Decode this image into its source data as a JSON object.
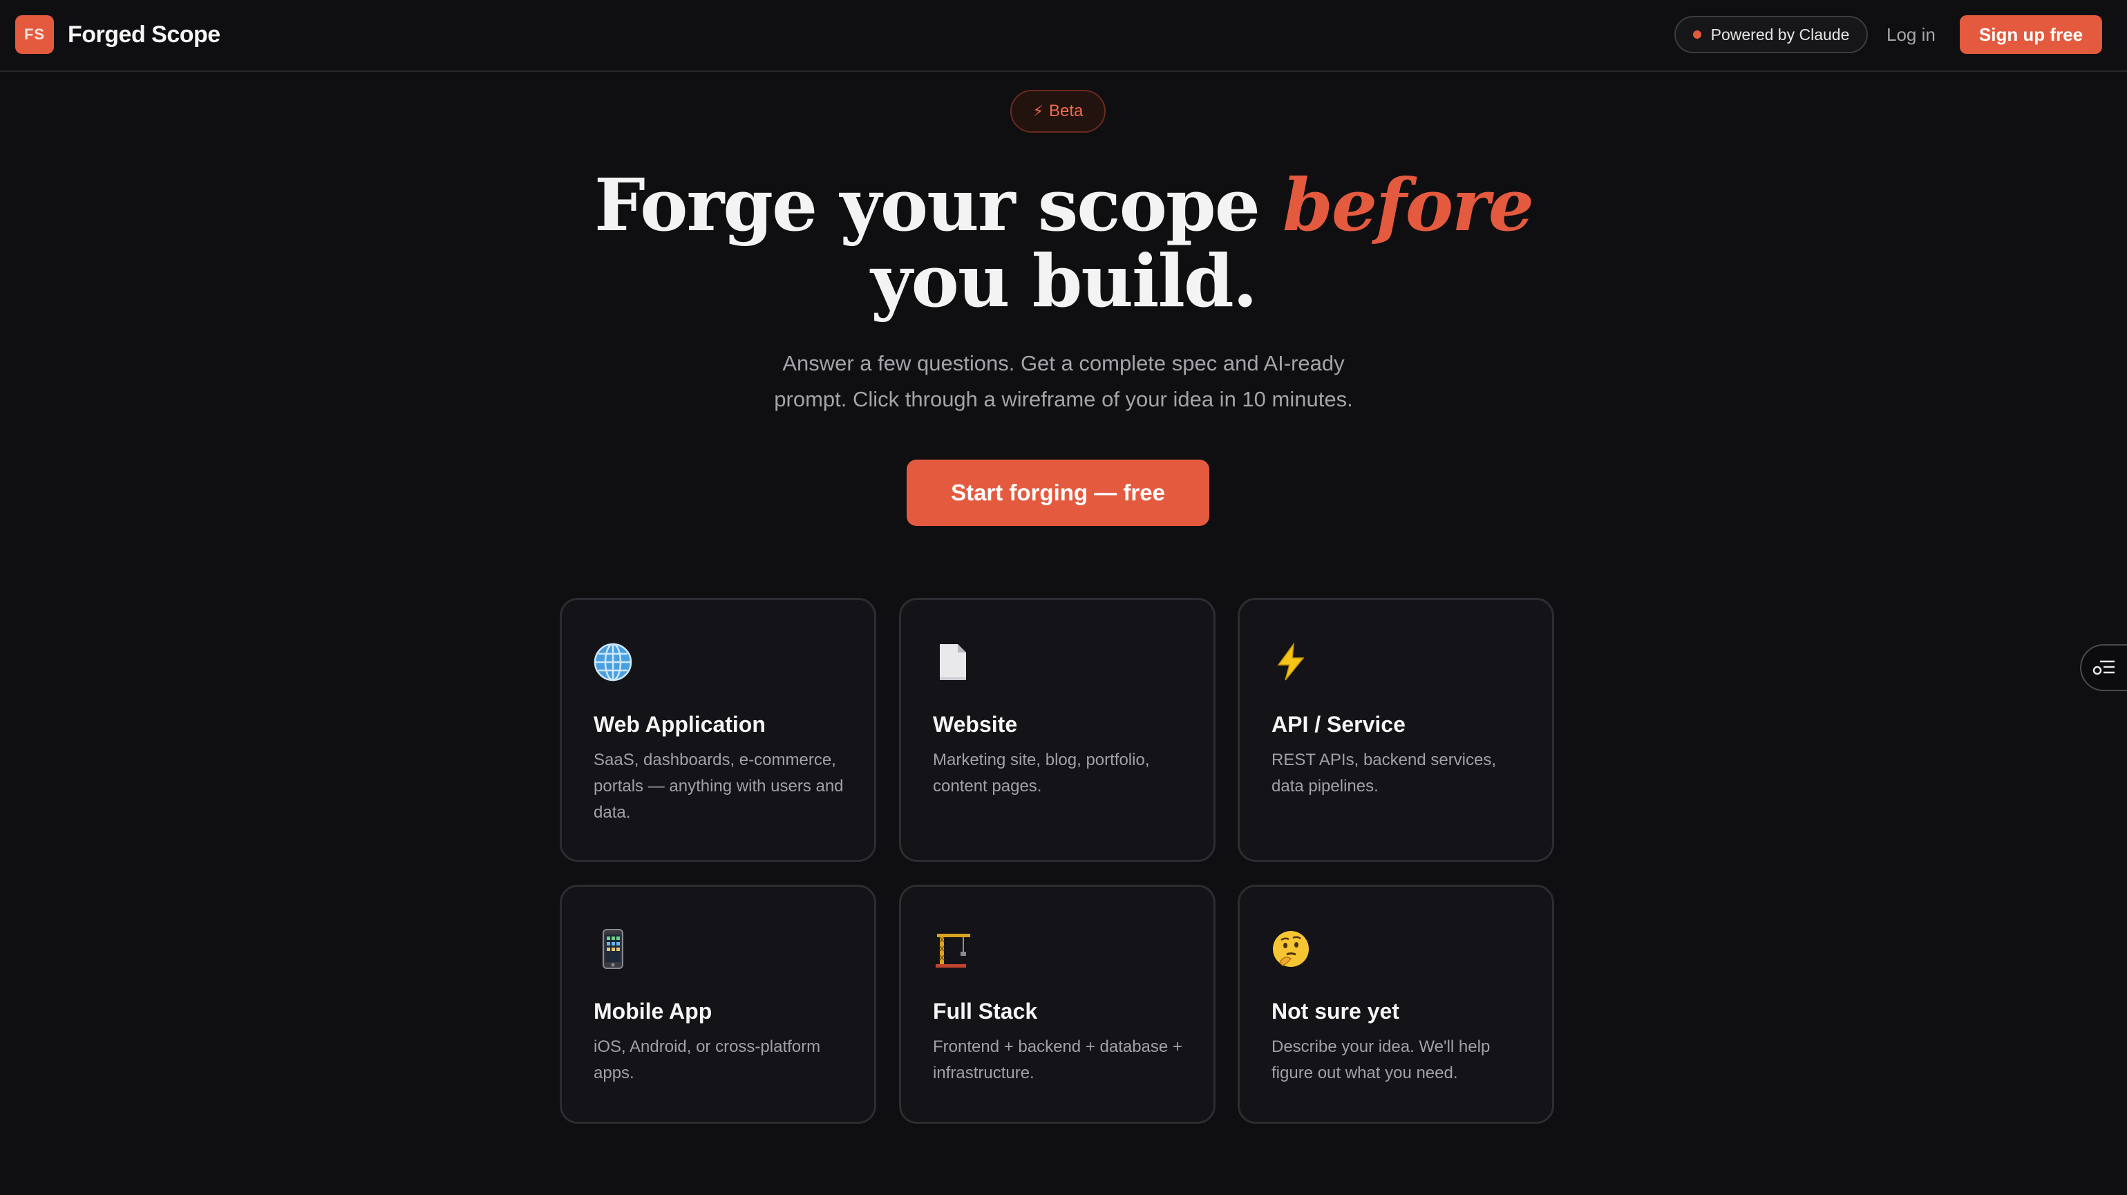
{
  "brand": {
    "logo_text": "FS",
    "name": "Forged Scope",
    "accent_color": "#e45a3f"
  },
  "nav": {
    "powered_label": "Powered by Claude",
    "login_label": "Log in",
    "signup_label": "Sign up free"
  },
  "hero": {
    "badge_icon": "lightning-icon",
    "badge_label": "Beta",
    "headline_part1": "Forge your scope ",
    "headline_accent": "before",
    "headline_part2": "you build.",
    "subtitle": "Answer a few questions. Get a complete spec and AI-ready prompt. Click through a wireframe of your idea in 10 minutes.",
    "cta_label": "Start forging — free"
  },
  "project_types": [
    {
      "icon": "globe-icon",
      "title": "Web Application",
      "description": "SaaS, dashboards, e-commerce, portals — anything with users and data."
    },
    {
      "icon": "document-icon",
      "title": "Website",
      "description": "Marketing site, blog, portfolio, content pages."
    },
    {
      "icon": "lightning-icon",
      "title": "API / Service",
      "description": "REST APIs, backend services, data pipelines."
    },
    {
      "icon": "mobile-phone-icon",
      "title": "Mobile App",
      "description": "iOS, Android, or cross-platform apps."
    },
    {
      "icon": "crane-icon",
      "title": "Full Stack",
      "description": "Frontend + backend + database + infrastructure."
    },
    {
      "icon": "thinking-face-icon",
      "title": "Not sure yet",
      "description": "Describe your idea. We'll help figure out what you need."
    }
  ],
  "side_widget": {
    "icon": "feedback-toggle-icon"
  }
}
